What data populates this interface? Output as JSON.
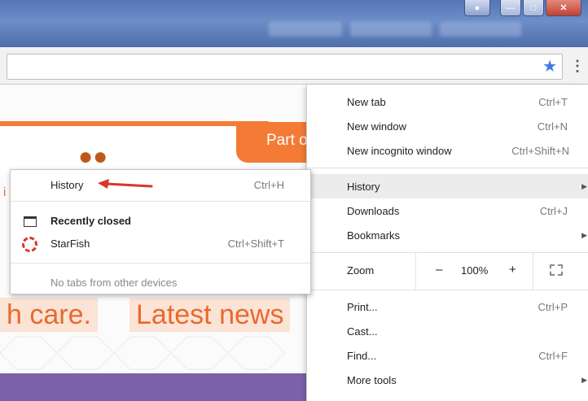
{
  "menu": {
    "new_tab": {
      "label": "New tab",
      "shortcut": "Ctrl+T"
    },
    "new_window": {
      "label": "New window",
      "shortcut": "Ctrl+N"
    },
    "new_incognito": {
      "label": "New incognito window",
      "shortcut": "Ctrl+Shift+N"
    },
    "history": {
      "label": "History"
    },
    "downloads": {
      "label": "Downloads",
      "shortcut": "Ctrl+J"
    },
    "bookmarks": {
      "label": "Bookmarks"
    },
    "zoom": {
      "label": "Zoom",
      "minus": "–",
      "value": "100%",
      "plus": "+"
    },
    "print": {
      "label": "Print...",
      "shortcut": "Ctrl+P"
    },
    "cast": {
      "label": "Cast..."
    },
    "find": {
      "label": "Find...",
      "shortcut": "Ctrl+F"
    },
    "more_tools": {
      "label": "More tools"
    }
  },
  "history_submenu": {
    "history": {
      "label": "History",
      "shortcut": "Ctrl+H"
    },
    "recently_closed": "Recently closed",
    "starfish": {
      "label": "StarFish",
      "shortcut": "Ctrl+Shift+T"
    },
    "no_tabs": "No tabs from other devices"
  },
  "page": {
    "part_of": "Part o",
    "left_text": "i",
    "big_text_1": "h care.",
    "big_text_2": "Latest news"
  },
  "colors": {
    "accent": "#3d7be2",
    "brand_orange": "#f37b36",
    "purple": "#7b62a8",
    "arrow_red": "#d9362b"
  },
  "icons": [
    "star-icon",
    "menu-kebab-icon",
    "tab-icon",
    "starfish-icon",
    "fullscreen-icon",
    "people-icon",
    "submenu-arrow-icon"
  ]
}
